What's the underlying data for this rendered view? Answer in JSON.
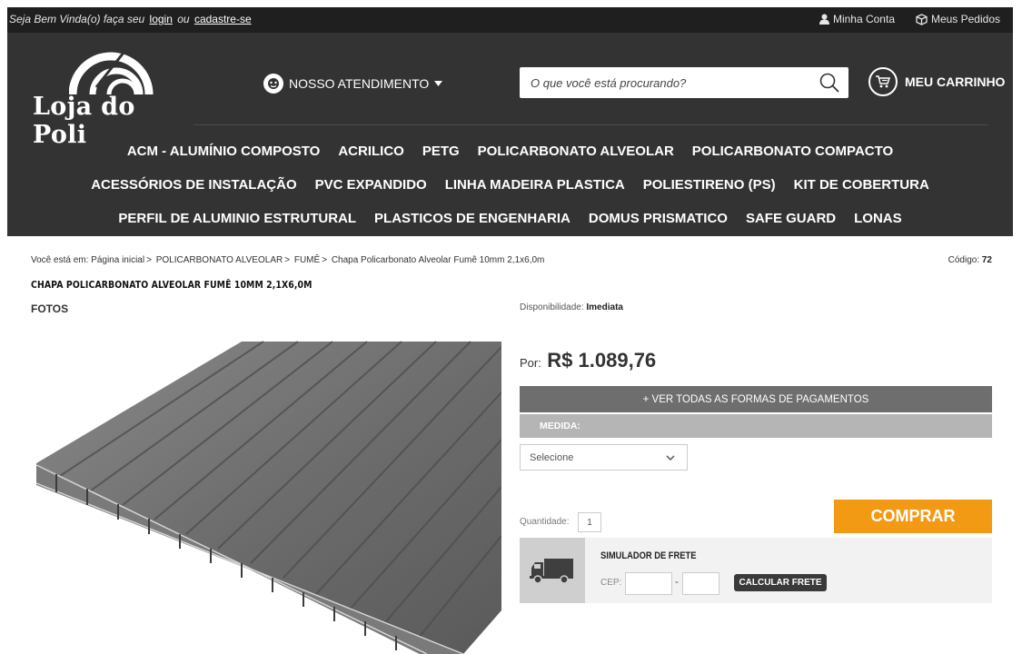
{
  "topbar": {
    "welcome_prefix": "Seja Bem Vinda(o) faça seu",
    "login": "login",
    "or": "ou",
    "register": "cadastre-se",
    "account": "Minha Conta",
    "orders": "Meus Pedidos"
  },
  "header": {
    "brand": "Loja do Poli",
    "support": "NOSSO ATENDIMENTO",
    "search_placeholder": "O que você está procurando?",
    "cart": "MEU CARRINHO"
  },
  "categories": [
    [
      "ACM - ALUMÍNIO COMPOSTO",
      "ACRILICO",
      "PETG",
      "POLICARBONATO ALVEOLAR",
      "POLICARBONATO COMPACTO"
    ],
    [
      "ACESSÓRIOS DE INSTALAÇÃO",
      "PVC EXPANDIDO",
      "LINHA MADEIRA PLASTICA",
      "POLIESTIRENO (PS)",
      "KIT DE COBERTURA"
    ],
    [
      "PERFIL DE ALUMINIO ESTRUTURAL",
      "PLASTICOS DE ENGENHARIA",
      "DOMUS PRISMATICO",
      "SAFE GUARD",
      "LONAS"
    ]
  ],
  "breadcrumb": {
    "prefix": "Você está em:",
    "items": [
      "Página inicial",
      "POLICARBONATO ALVEOLAR",
      "FUMÊ",
      "Chapa Policarbonato Alveolar Fumê 10mm 2,1x6,0m"
    ],
    "code_label": "Código:",
    "code_value": "72"
  },
  "product": {
    "title": "CHAPA POLICARBONATO ALVEOLAR FUMÊ 10MM 2,1X6,0M",
    "photos_label": "FOTOS",
    "availability_label": "Disponibilidade:",
    "availability_value": "Imediata",
    "price_prefix": "Por:",
    "price": "R$ 1.089,76",
    "payments_button": "+ VER TODAS AS FORMAS DE PAGAMENTOS",
    "measure_label": "MEDIDA:",
    "measure_select": "Selecione",
    "quantity_label": "Quantidade:",
    "quantity_value": "1",
    "buy_button": "COMPRAR"
  },
  "shipping": {
    "title": "SIMULADOR DE FRETE",
    "cep_label": "CEP:",
    "dash": "-",
    "calc_button": "CALCULAR FRETE"
  },
  "colors": {
    "header_bg": "#333333",
    "buy_orange": "#f29a14",
    "pay_gray": "#6e6e6e"
  }
}
